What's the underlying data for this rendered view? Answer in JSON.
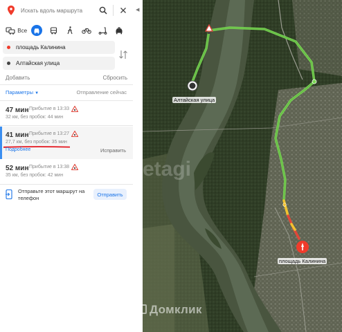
{
  "search": {
    "placeholder": "Искать вдоль маршрута"
  },
  "modes": {
    "all_label": "Все"
  },
  "route_points": {
    "from": "площадь Калинина",
    "to": "Алтайская улица"
  },
  "actions": {
    "add": "Добавить",
    "reset": "Сбросить"
  },
  "params": {
    "label": "Параметры",
    "departure": "Отправление сейчас"
  },
  "routes": [
    {
      "time": "47 мин",
      "arrival": "Прибытие в 13:33",
      "details": "32 км, без пробок: 44 мин"
    },
    {
      "time": "41 мин",
      "arrival": "Прибытие в 13:27",
      "details": "27,7 км, без пробок: 35 мин",
      "more": "Подробнее",
      "edit": "Исправить"
    },
    {
      "time": "52 мин",
      "arrival": "Прибытие в 13:38",
      "details": "35 км, без пробок: 42 мин"
    }
  ],
  "send": {
    "text": "Отправьте этот маршрут на телефон",
    "button": "Отправить"
  },
  "map": {
    "from_label": "площадь Калинина",
    "to_label": "Алтайская улица",
    "watermark": "Домклик",
    "watermark2": "etagi"
  },
  "colors": {
    "accent": "#1a74e8",
    "route": "#7fd858",
    "traffic_red": "#e0453a",
    "traffic_yellow": "#f2c230"
  }
}
